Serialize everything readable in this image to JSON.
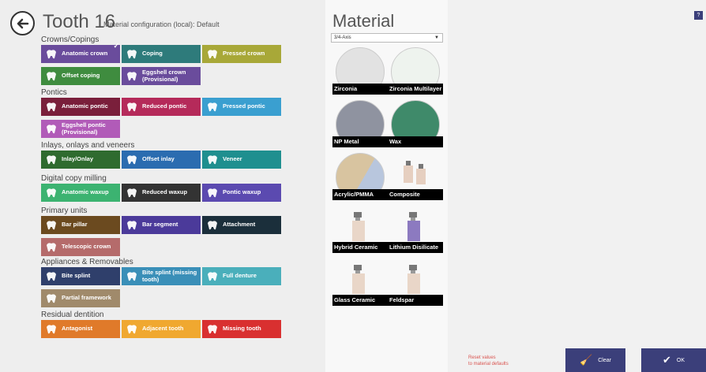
{
  "header": {
    "title": "Tooth 16",
    "subtitle": "Material configuration (local):  Default"
  },
  "sections": [
    {
      "title": "Crowns/Copings",
      "tiles": [
        {
          "label": "Anatomic crown",
          "color": "#6a4c9c",
          "icon": "anatomic-crown-icon",
          "selected": true
        },
        {
          "label": "Coping",
          "color": "#2e7b7b",
          "icon": "coping-icon"
        },
        {
          "label": "Pressed crown",
          "color": "#a8a838",
          "icon": "pressed-crown-icon"
        },
        {
          "label": "Offset coping",
          "color": "#3f8c3f",
          "icon": "offset-coping-icon"
        },
        {
          "label": "Eggshell crown (Provisional)",
          "color": "#6a4c9c",
          "icon": "eggshell-crown-icon"
        }
      ]
    },
    {
      "title": "Pontics",
      "tiles": [
        {
          "label": "Anatomic pontic",
          "color": "#7a1f3b",
          "icon": "anatomic-pontic-icon"
        },
        {
          "label": "Reduced pontic",
          "color": "#b52a5a",
          "icon": "reduced-pontic-icon"
        },
        {
          "label": "Pressed pontic",
          "color": "#3a9fd0",
          "icon": "pressed-pontic-icon"
        },
        {
          "label": "Eggshell pontic (Provisional)",
          "color": "#b15bb8",
          "icon": "eggshell-pontic-icon"
        }
      ]
    },
    {
      "title": "Inlays, onlays and veneers",
      "tiles": [
        {
          "label": "Inlay/Onlay",
          "color": "#2f6b2f",
          "icon": "inlay-onlay-icon"
        },
        {
          "label": "Offset inlay",
          "color": "#2b6cb0",
          "icon": "offset-inlay-icon"
        },
        {
          "label": "Veneer",
          "color": "#1f8f8f",
          "icon": "veneer-icon"
        }
      ]
    },
    {
      "title": "Digital copy milling",
      "tiles": [
        {
          "label": "Anatomic waxup",
          "color": "#3cb371",
          "icon": "anatomic-waxup-icon"
        },
        {
          "label": "Reduced waxup",
          "color": "#333333",
          "icon": "reduced-waxup-icon"
        },
        {
          "label": "Pontic waxup",
          "color": "#5b4ab0",
          "icon": "pontic-waxup-icon"
        }
      ]
    },
    {
      "title": "Primary units",
      "tiles": [
        {
          "label": "Bar pillar",
          "color": "#6b4a1f",
          "icon": "bar-pillar-icon"
        },
        {
          "label": "Bar segment",
          "color": "#4b3a9a",
          "icon": "bar-segment-icon"
        },
        {
          "label": "Attachment",
          "color": "#1b2f3b",
          "icon": "attachment-icon"
        },
        {
          "label": "Telescopic crown",
          "color": "#b56b6b",
          "icon": "telescopic-crown-icon"
        }
      ]
    },
    {
      "title": "Appliances & Removables",
      "tiles": [
        {
          "label": "Bite splint",
          "color": "#2f3f6b",
          "icon": "bite-splint-icon"
        },
        {
          "label": "Bite splint (missing tooth)",
          "color": "#3a8fb8",
          "icon": "bite-splint-missing-icon"
        },
        {
          "label": "Full denture",
          "color": "#4aafbb",
          "icon": "full-denture-icon"
        },
        {
          "label": "Partial framework",
          "color": "#a08a6b",
          "icon": "partial-framework-icon"
        }
      ]
    },
    {
      "title": "Residual dentition",
      "tiles": [
        {
          "label": "Antagonist",
          "color": "#e07a2a",
          "icon": "antagonist-icon"
        },
        {
          "label": "Adjacent tooth",
          "color": "#f0a830",
          "icon": "adjacent-tooth-icon"
        },
        {
          "label": "Missing tooth",
          "color": "#d93030",
          "icon": "missing-tooth-icon"
        }
      ]
    }
  ],
  "material": {
    "title": "Material",
    "dropdown_value": "3/4-Axis",
    "items": [
      {
        "label": "Zirconia",
        "kind": "disc",
        "color": "#e2e2e2"
      },
      {
        "label": "Zirconia Multilayer",
        "kind": "disc",
        "color": "#eef3ee"
      },
      {
        "label": "NP Metal",
        "kind": "disc",
        "color": "#8f93a0"
      },
      {
        "label": "Wax",
        "kind": "disc",
        "color": "#3f8a6a"
      },
      {
        "label": "Acrylic/PMMA",
        "kind": "disc-split",
        "color": "#d8c4a0",
        "color2": "#b8c6dd"
      },
      {
        "label": "Composite",
        "kind": "blocks",
        "color": "#e6cfc0"
      },
      {
        "label": "Hybrid Ceramic",
        "kind": "block",
        "color": "#e9d6c8"
      },
      {
        "label": "Lithium Disilicate",
        "kind": "block",
        "color": "#8c7ac0"
      },
      {
        "label": "Glass Ceramic",
        "kind": "block",
        "color": "#e9d6c8"
      },
      {
        "label": "Feldspar",
        "kind": "block",
        "color": "#e9d6c8"
      }
    ]
  },
  "footer": {
    "help_label": "?",
    "reset_label_1": "Reset values",
    "reset_label_2": "to material defaults",
    "clear_label": "Clear",
    "ok_label": "OK"
  }
}
